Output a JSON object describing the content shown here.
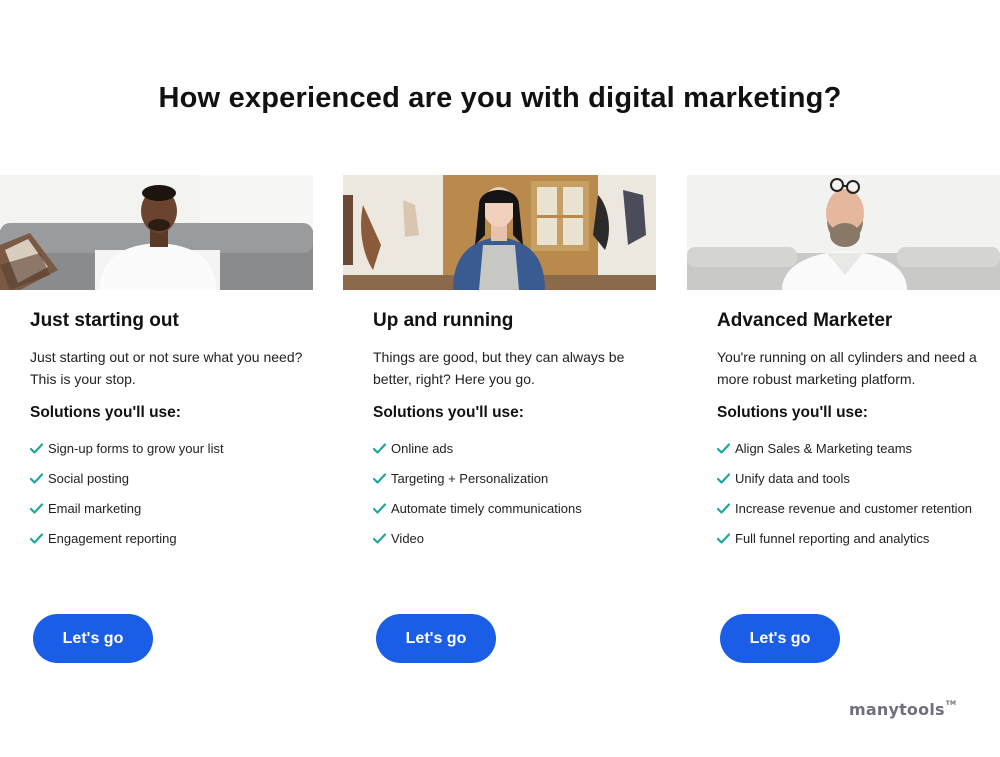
{
  "page": {
    "title": "How experienced are you with digital marketing?"
  },
  "cards": [
    {
      "title": "Just starting out",
      "description": "Just starting out or not sure what you need? This is your stop.",
      "solutions_heading": "Solutions you'll use:",
      "features": [
        "Sign-up forms to grow your list",
        "Social posting",
        "Email marketing",
        "Engagement reporting"
      ],
      "cta_label": "Let's go"
    },
    {
      "title": "Up and running",
      "description": "Things are good, but they can always be better, right? Here you go.",
      "solutions_heading": "Solutions you'll use:",
      "features": [
        "Online ads",
        "Targeting + Personalization",
        "Automate timely communications",
        "Video"
      ],
      "cta_label": "Let's go"
    },
    {
      "title": "Advanced Marketer",
      "description": "You're running on all cylinders and need a more robust marketing platform.",
      "solutions_heading": "Solutions you'll use:",
      "features": [
        "Align Sales & Marketing teams",
        "Unify data and tools",
        "Increase revenue and customer retention",
        "Full funnel reporting and analytics"
      ],
      "cta_label": "Let's go"
    }
  ],
  "watermark": {
    "text": "manytools",
    "tm": "TM"
  },
  "colors": {
    "accent": "#1a5ee8",
    "check": "#1fa6a0",
    "text": "#111111"
  },
  "icons": {
    "check": "check-icon"
  }
}
